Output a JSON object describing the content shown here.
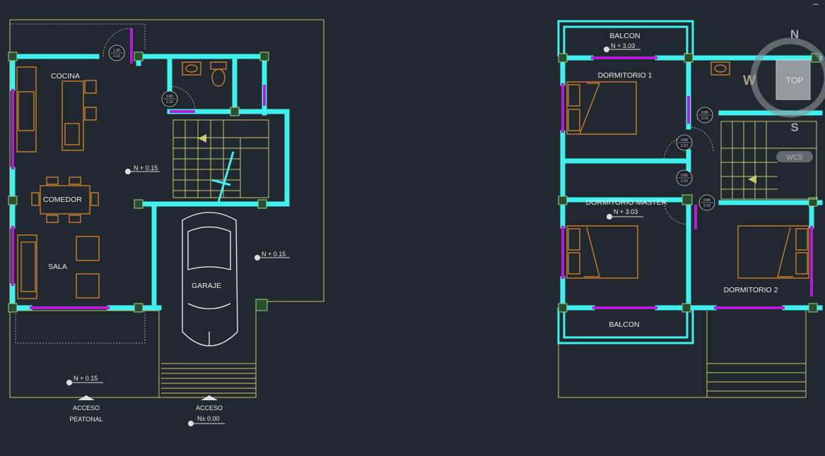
{
  "window": {
    "minimize_label": "–"
  },
  "ground_floor": {
    "rooms": {
      "cocina": "COCINA",
      "comedor": "COMEDOR",
      "sala": "SALA",
      "garaje": "GARAJE"
    },
    "levels": {
      "stair": "N + 0.15",
      "garage": "N + 0.15",
      "entry": "N + 0.15",
      "access": "N± 0.00"
    },
    "access": {
      "pedestrian_line1": "ACCESO",
      "pedestrian_line2": "PEATONAL",
      "vehicle": "ACCESO"
    },
    "door_tags": [
      {
        "a": "1.00",
        "b": "2.10"
      },
      {
        "a": "0.80",
        "b": "2.10"
      }
    ]
  },
  "upper_floor": {
    "rooms": {
      "balcon_top": "BALCON",
      "dormitorio1": "DORMITORIO 1",
      "master": "DORMITORIO MASTER",
      "dormitorio2": "DORMITORIO 2",
      "balcon_bottom": "BALCON"
    },
    "levels": {
      "balcon": "N + 3.03",
      "master": "N + 3.03"
    },
    "door_tags": [
      {
        "a": "0.80",
        "b": "2.10"
      },
      {
        "a": "0.80",
        "b": "2.10"
      },
      {
        "a": "0.80",
        "b": "2.10"
      },
      {
        "a": "0.80",
        "b": "2.10"
      }
    ]
  },
  "viewcube": {
    "north": "N",
    "west": "W",
    "south": "S",
    "top": "TOP",
    "wcs": "WCS"
  },
  "colors": {
    "background": "#212830",
    "walls": "#3ff0ee",
    "windows": "#b31fd6",
    "furniture": "#d8862a",
    "outline": "#c7c96c"
  }
}
